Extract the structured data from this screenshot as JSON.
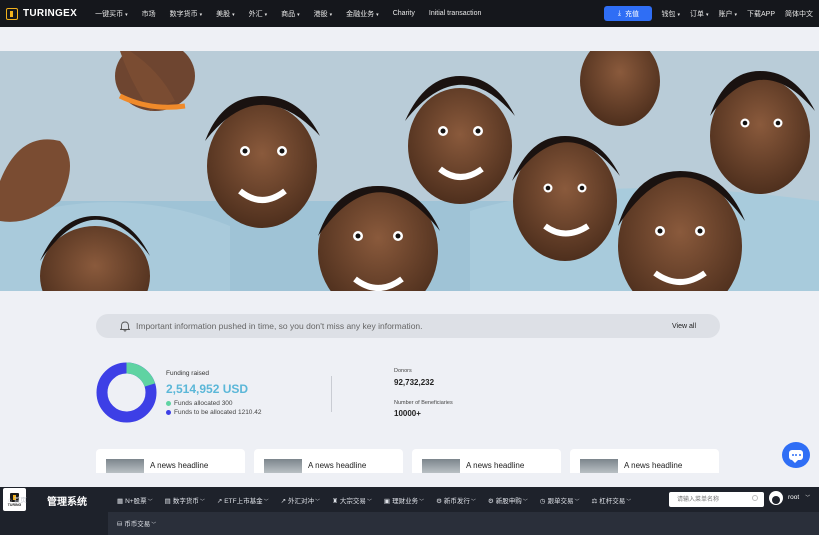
{
  "topnav": {
    "logo_text": "TURINGEX",
    "items": [
      {
        "label": "一键买币",
        "caret": "▾"
      },
      {
        "label": "市场",
        "caret": ""
      },
      {
        "label": "数字货币",
        "caret": "▾"
      },
      {
        "label": "美股",
        "caret": "▾"
      },
      {
        "label": "外汇",
        "caret": "▾"
      },
      {
        "label": "商品",
        "caret": "▾"
      },
      {
        "label": "港股",
        "caret": "▾"
      },
      {
        "label": "金融业务",
        "caret": "▾"
      },
      {
        "label": "Charity",
        "caret": ""
      },
      {
        "label": "Initial transaction",
        "caret": ""
      }
    ],
    "recharge_label": "充值",
    "right_items": [
      {
        "label": "钱包",
        "caret": "▾"
      },
      {
        "label": "订单",
        "caret": "▾"
      },
      {
        "label": "账户",
        "caret": "▾"
      },
      {
        "label": "下载APP",
        "caret": ""
      },
      {
        "label": "简体中文",
        "caret": ""
      }
    ]
  },
  "notice": {
    "text": "Important information pushed in time, so you don't miss any key information.",
    "view_all": "View all"
  },
  "funding": {
    "label": "Funding raised",
    "value": "2,514,952 USD",
    "allocated_label": "Funds allocated 300",
    "to_allocate_label": "Funds to be allocated 1210.42",
    "allocated_color": "#5fd3a2",
    "to_allocate_color": "#3d3fe6",
    "allocated_fraction": 0.2
  },
  "stats": {
    "donors_label": "Donors",
    "donors_value": "92,732,232",
    "beneficiaries_label": "Number of Beneficiaries",
    "beneficiaries_value": "10000+"
  },
  "news": [
    {
      "title": "A news headline"
    },
    {
      "title": "A news headline"
    },
    {
      "title": "A news headline"
    },
    {
      "title": "A news headline"
    }
  ],
  "admin": {
    "logo_text": "TURING",
    "title": "管理系统",
    "menu": [
      {
        "icon": "▦",
        "label": "N+股票"
      },
      {
        "icon": "▤",
        "label": "数字货币"
      },
      {
        "icon": "↗",
        "label": "ETF上市基金"
      },
      {
        "icon": "↗",
        "label": "外汇对冲"
      },
      {
        "icon": "♜",
        "label": "大宗交易"
      },
      {
        "icon": "▣",
        "label": "理财业务"
      },
      {
        "icon": "⚙",
        "label": "新币发行"
      },
      {
        "icon": "⚙",
        "label": "新股申购"
      },
      {
        "icon": "◷",
        "label": "跟单交易"
      },
      {
        "icon": "⚖",
        "label": "杠杆交易"
      }
    ],
    "search_placeholder": "请输入菜单名称",
    "user": "root",
    "home": "首页",
    "sub_menu": "币币交易"
  },
  "icons": {
    "bell": "bell-icon",
    "chat": "chat-icon",
    "download": "download-icon",
    "search": "search-icon"
  }
}
